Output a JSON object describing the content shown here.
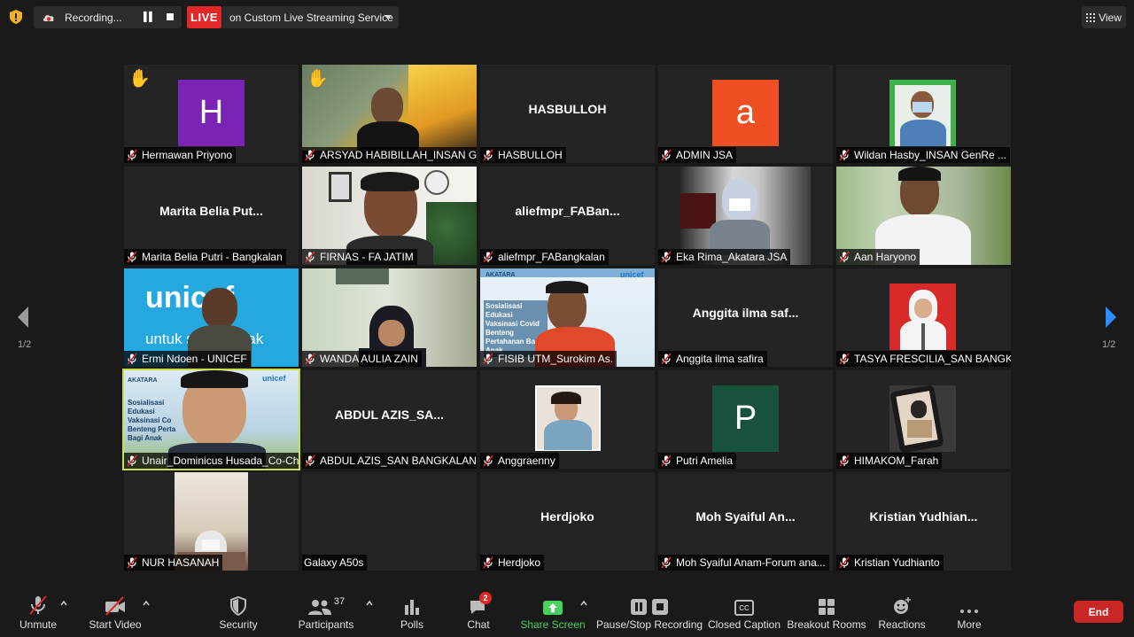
{
  "topbar": {
    "recording_label": "Recording...",
    "live_label": "LIVE",
    "live_service": "on Custom Live Streaming Service",
    "view_label": "View"
  },
  "pager": {
    "left": "1/2",
    "right": "1/2"
  },
  "tiles": [
    {
      "name": "Hermawan Priyono",
      "big": "",
      "avatar": "H",
      "avatar_color": "#7b23b5",
      "hand": true
    },
    {
      "name": "ARSYAD HABIBILLAH_INSAN G...",
      "big": "",
      "avatar": "",
      "hand": true
    },
    {
      "name": "HASBULLOH",
      "big": "HASBULLOH",
      "avatar": ""
    },
    {
      "name": "ADMIN JSA",
      "big": "",
      "avatar": "a",
      "avatar_color": "#f04e23"
    },
    {
      "name": "Wildan Hasby_INSAN GenRe ...",
      "big": "",
      "avatar": ""
    },
    {
      "name": "Marita Belia Putri - Bangkalan",
      "big": "Marita Belia Put...",
      "avatar": ""
    },
    {
      "name": "FIRNAS - FA JATIM",
      "big": "",
      "avatar": ""
    },
    {
      "name": "aliefmpr_FABangkalan",
      "big": "aliefmpr_FABan...",
      "avatar": ""
    },
    {
      "name": "Eka Rima_Akatara JSA",
      "big": "",
      "avatar": ""
    },
    {
      "name": "Aan Haryono",
      "big": "",
      "avatar": ""
    },
    {
      "name": "Ermi Ndoen - UNICEF",
      "big": "",
      "avatar": ""
    },
    {
      "name": "WANDA AULIA ZAIN",
      "big": "",
      "avatar": ""
    },
    {
      "name": "FISIB UTM_Surokim As.",
      "big": "",
      "avatar": ""
    },
    {
      "name": "Anggita ilma safira",
      "big": "Anggita ilma saf...",
      "avatar": ""
    },
    {
      "name": "TASYA FRESCILIA_SAN BANGK...",
      "big": "",
      "avatar": ""
    },
    {
      "name": "Unair_Dominicus Husada_Co-Chair",
      "big": "",
      "avatar": "",
      "active": true
    },
    {
      "name": "ABDUL AZIS_SAN BANGKALAN",
      "big": "ABDUL AZIS_SA...",
      "avatar": ""
    },
    {
      "name": "Anggraenny",
      "big": "",
      "avatar": ""
    },
    {
      "name": "Putri Amelia",
      "big": "",
      "avatar": "P",
      "avatar_color": "#17533b"
    },
    {
      "name": "HIMAKOM_Farah",
      "big": "",
      "avatar": ""
    },
    {
      "name": "NUR HASANAH",
      "big": "",
      "avatar": ""
    },
    {
      "name": "Galaxy A50s",
      "big": "",
      "avatar": "",
      "nomic": true
    },
    {
      "name": "Herdjoko",
      "big": "Herdjoko",
      "avatar": ""
    },
    {
      "name": "Moh Syaiful Anam-Forum ana...",
      "big": "Moh Syaiful An...",
      "avatar": ""
    },
    {
      "name": "Kristian Yudhianto",
      "big": "Kristian Yudhian...",
      "avatar": ""
    }
  ],
  "video_text": {
    "unicef": "unicef",
    "unicef_tagline": "untuk setiap anak",
    "slide_brand": "AKATARA",
    "slide_title": "Sosialisasi Edukasi Vaksinasi Covid Benteng Pertahanan Bagi Anak",
    "slide_title_small": "Sosialisasi Edukasi Vaksinasi Co Benteng Perta Bagi Anak",
    "slide_unicef": "unicef"
  },
  "toolbar": {
    "unmute": "Unmute",
    "start_video": "Start Video",
    "security": "Security",
    "participants": "Participants",
    "participants_count": "37",
    "polls": "Polls",
    "chat": "Chat",
    "chat_badge": "2",
    "share_screen": "Share Screen",
    "pause_stop": "Pause/Stop Recording",
    "closed_caption": "Closed Caption",
    "cc_icon_text": "CC",
    "breakout": "Breakout Rooms",
    "reactions": "Reactions",
    "more": "More",
    "end": "End"
  },
  "colors": {
    "background": "#1a1a1a",
    "tile": "#242424",
    "live_red": "#e02828",
    "share_green": "#45d15b",
    "active_border": "#c7dd54"
  }
}
